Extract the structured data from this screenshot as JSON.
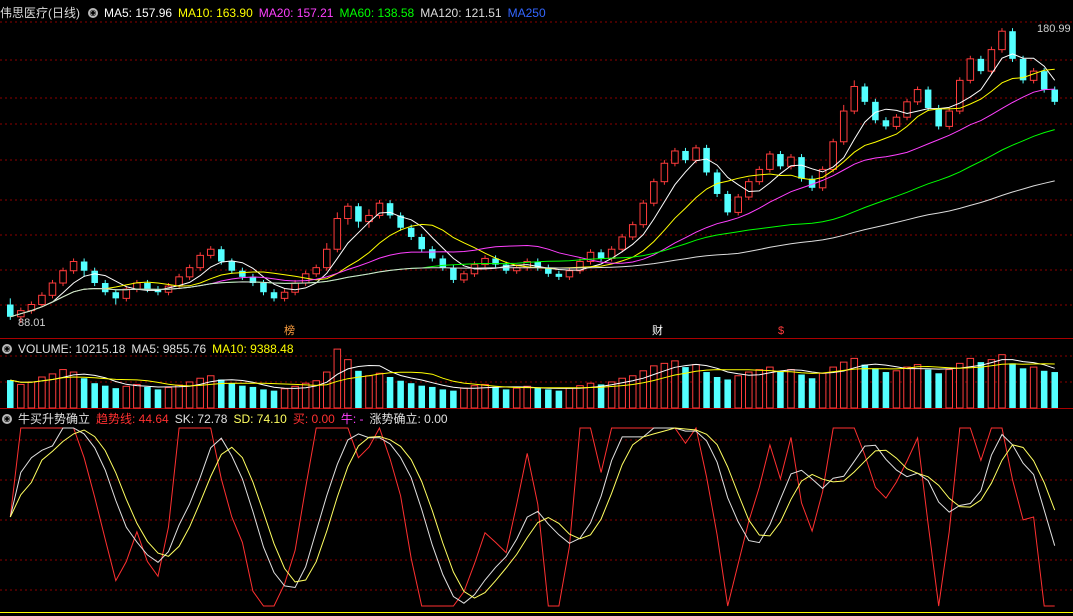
{
  "main": {
    "title": "伟思医疗(日线)",
    "mas": [
      {
        "label": "MA5: 157.96",
        "color": "#ffffff"
      },
      {
        "label": "MA10: 163.90",
        "color": "#ffff00"
      },
      {
        "label": "MA20: 157.21",
        "color": "#ff40ff"
      },
      {
        "label": "MA60: 138.58",
        "color": "#00ff00"
      },
      {
        "label": "MA120: 121.51",
        "color": "#dcdcdc"
      },
      {
        "label": "MA250",
        "color": "#3366ff"
      }
    ],
    "high_label": "180.99",
    "low_label": "88.01",
    "markers": [
      "榜",
      "财",
      "$"
    ]
  },
  "volume": {
    "title": "VOLUME: 10215.18",
    "ma5": "MA5: 9855.76",
    "ma10": "MA10: 9388.48"
  },
  "indicator": {
    "title": "牛买升势确立",
    "items": [
      {
        "label": "趋势线: 44.64",
        "color": "#ff3030"
      },
      {
        "label": "SK: 72.78",
        "color": "#e0e0e0"
      },
      {
        "label": "SD: 74.10",
        "color": "#ffff60"
      },
      {
        "label": "买: 0.00",
        "color": "#ff3030"
      },
      {
        "label": "牛: -",
        "color": "#ff40ff"
      },
      {
        "label": "涨势确立: 0.00",
        "color": "#e0e0e0"
      }
    ]
  },
  "colors": {
    "up": "#ff3c3c",
    "down": "#54ffff",
    "grid": "#8b0000",
    "divider": "#aa0000"
  },
  "chart_data": {
    "type": "candlestick",
    "candles": [
      [
        92,
        88,
        94,
        87
      ],
      [
        88,
        90,
        91,
        86
      ],
      [
        90,
        92,
        93,
        89
      ],
      [
        92,
        95,
        96,
        91
      ],
      [
        95,
        99,
        100,
        94
      ],
      [
        99,
        103,
        104,
        98
      ],
      [
        103,
        106,
        107,
        102
      ],
      [
        106,
        103,
        107,
        101
      ],
      [
        103,
        99,
        104,
        98
      ],
      [
        99,
        96,
        100,
        95
      ],
      [
        96,
        94,
        97,
        92
      ],
      [
        94,
        97,
        98,
        93
      ],
      [
        97,
        99,
        100,
        96
      ],
      [
        99,
        97,
        100,
        96
      ],
      [
        97,
        96,
        98,
        95
      ],
      [
        96,
        98,
        99,
        95
      ],
      [
        98,
        101,
        102,
        97
      ],
      [
        101,
        104,
        105,
        100
      ],
      [
        104,
        108,
        109,
        103
      ],
      [
        108,
        110,
        111,
        107
      ],
      [
        110,
        106,
        111,
        105
      ],
      [
        106,
        103,
        107,
        102
      ],
      [
        103,
        101,
        104,
        100
      ],
      [
        101,
        99,
        102,
        98
      ],
      [
        99,
        96,
        100,
        95
      ],
      [
        96,
        94,
        97,
        93
      ],
      [
        94,
        96,
        97,
        93
      ],
      [
        96,
        99,
        100,
        95
      ],
      [
        99,
        102,
        103,
        98
      ],
      [
        102,
        104,
        105,
        101
      ],
      [
        104,
        110,
        112,
        103
      ],
      [
        110,
        120,
        122,
        109
      ],
      [
        120,
        124,
        125,
        118
      ],
      [
        124,
        119,
        125,
        117
      ],
      [
        119,
        121,
        123,
        117
      ],
      [
        121,
        125,
        126,
        120
      ],
      [
        125,
        121,
        126,
        120
      ],
      [
        121,
        117,
        122,
        116
      ],
      [
        117,
        114,
        118,
        113
      ],
      [
        114,
        110,
        115,
        109
      ],
      [
        110,
        107,
        111,
        106
      ],
      [
        107,
        104,
        108,
        103
      ],
      [
        104,
        100,
        105,
        99
      ],
      [
        100,
        102,
        103,
        99
      ],
      [
        102,
        105,
        106,
        101
      ],
      [
        105,
        107,
        108,
        104
      ],
      [
        107,
        105,
        108,
        104
      ],
      [
        105,
        103,
        106,
        102
      ],
      [
        103,
        104,
        105,
        102
      ],
      [
        104,
        106,
        107,
        103
      ],
      [
        106,
        104,
        107,
        103
      ],
      [
        104,
        102,
        105,
        101
      ],
      [
        102,
        101,
        103,
        100
      ],
      [
        101,
        103,
        104,
        100
      ],
      [
        103,
        106,
        107,
        102
      ],
      [
        106,
        109,
        110,
        105
      ],
      [
        109,
        107,
        110,
        106
      ],
      [
        107,
        110,
        111,
        106
      ],
      [
        110,
        114,
        115,
        109
      ],
      [
        114,
        118,
        119,
        113
      ],
      [
        118,
        125,
        126,
        117
      ],
      [
        125,
        132,
        133,
        124
      ],
      [
        132,
        138,
        139,
        131
      ],
      [
        138,
        142,
        143,
        137
      ],
      [
        142,
        139,
        143,
        138
      ],
      [
        139,
        143,
        144,
        138
      ],
      [
        143,
        135,
        144,
        134
      ],
      [
        135,
        128,
        136,
        127
      ],
      [
        128,
        122,
        129,
        121
      ],
      [
        122,
        127,
        128,
        121
      ],
      [
        127,
        132,
        133,
        126
      ],
      [
        132,
        136,
        137,
        131
      ],
      [
        136,
        141,
        142,
        135
      ],
      [
        141,
        137,
        142,
        136
      ],
      [
        137,
        140,
        141,
        136
      ],
      [
        140,
        133,
        141,
        132
      ],
      [
        133,
        130,
        134,
        129
      ],
      [
        130,
        136,
        137,
        129
      ],
      [
        136,
        145,
        146,
        135
      ],
      [
        145,
        155,
        157,
        144
      ],
      [
        155,
        163,
        165,
        154
      ],
      [
        163,
        158,
        164,
        157
      ],
      [
        158,
        152,
        159,
        151
      ],
      [
        152,
        150,
        153,
        149
      ],
      [
        150,
        153,
        154,
        149
      ],
      [
        153,
        158,
        159,
        152
      ],
      [
        158,
        162,
        163,
        157
      ],
      [
        162,
        156,
        163,
        155
      ],
      [
        156,
        150,
        157,
        149
      ],
      [
        150,
        155,
        156,
        149
      ],
      [
        155,
        165,
        166,
        154
      ],
      [
        165,
        172,
        173,
        164
      ],
      [
        172,
        168,
        173,
        167
      ],
      [
        168,
        175,
        176,
        167
      ],
      [
        175,
        181,
        182,
        174
      ],
      [
        181,
        172,
        182,
        171
      ],
      [
        172,
        165,
        173,
        164
      ],
      [
        165,
        168,
        169,
        164
      ],
      [
        168,
        162,
        169,
        161
      ],
      [
        162,
        158,
        163,
        157
      ]
    ],
    "volumes": [
      45,
      38,
      42,
      50,
      55,
      62,
      58,
      48,
      40,
      36,
      32,
      35,
      38,
      34,
      30,
      33,
      37,
      42,
      48,
      52,
      46,
      40,
      36,
      34,
      30,
      28,
      31,
      35,
      40,
      44,
      58,
      95,
      78,
      60,
      52,
      56,
      50,
      44,
      40,
      36,
      34,
      30,
      28,
      32,
      36,
      38,
      34,
      30,
      32,
      35,
      33,
      30,
      28,
      32,
      36,
      40,
      38,
      42,
      48,
      52,
      60,
      68,
      72,
      76,
      66,
      70,
      58,
      50,
      46,
      52,
      58,
      62,
      66,
      60,
      62,
      54,
      48,
      56,
      66,
      74,
      80,
      70,
      64,
      58,
      60,
      66,
      70,
      62,
      56,
      62,
      72,
      80,
      74,
      78,
      86,
      72,
      64,
      66,
      60,
      58
    ],
    "ylim": [
      85,
      184
    ],
    "vol_max": 100
  }
}
